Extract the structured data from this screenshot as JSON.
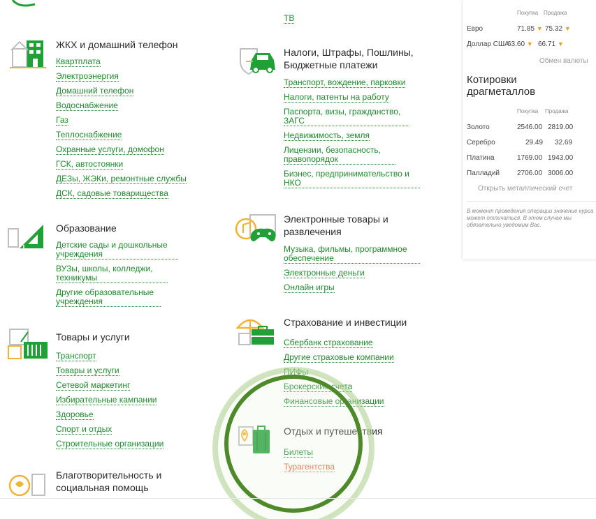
{
  "top_link": "ТВ",
  "categories_left": [
    {
      "title": "ЖКХ и домашний телефон",
      "links": [
        "Квартплата",
        "Электроэнергия",
        "Домашний телефон",
        "Водоснабжение",
        "Газ",
        "Теплоснабжение",
        "Охранные услуги, домофон",
        "ГСК, автостоянки",
        "ДЕЗы, ЖЭКи, ремонтные службы",
        "ДСК, садовые товарищества"
      ]
    },
    {
      "title": "Образование",
      "links": [
        "Детские сады и дошкольные учреждения",
        "ВУЗы, школы, колледжи, техникумы",
        "Другие образовательные учреждения"
      ]
    },
    {
      "title": "Товары и услуги",
      "links": [
        "Транспорт",
        "Товары и услуги",
        "Сетевой маркетинг",
        "Избирательные кампании",
        "Здоровье",
        "Спорт и отдых",
        "Строительные организации"
      ]
    },
    {
      "title": "Благотворительность и социальная помощь",
      "links": []
    }
  ],
  "categories_mid": [
    {
      "title": "Налоги, Штрафы, Пошлины, Бюджетные платежи",
      "links": [
        "Транспорт, вождение, парковки",
        "Налоги, патенты на работу",
        "Паспорта, визы, гражданство, ЗАГС",
        "Недвижимость, земля",
        "Лицензии, безопасность, правопорядок",
        "Бизнес, предпринимательство и НКО"
      ]
    },
    {
      "title": "Электронные товары и развлечения",
      "links": [
        "Музыка, фильмы, программное обеспечение",
        "Электронные деньги",
        "Онлайн игры"
      ]
    },
    {
      "title": "Страхование и инвестиции",
      "links": [
        "Сбербанк страхование",
        "Другие страховые компании",
        "ПИФы",
        "Брокерские счета",
        "Финансовые организации"
      ]
    },
    {
      "title": "Отдых и путешествия",
      "links": [
        "Билеты",
        "Турагентства"
      ]
    }
  ],
  "currency": {
    "header_buy": "Покупка",
    "header_sell": "Продажа",
    "rows": [
      {
        "name": "Евро",
        "buy": "71.85",
        "sell": "75.32"
      },
      {
        "name": "Доллар США",
        "buy": "63.60",
        "sell": "66.71"
      }
    ],
    "exchange_link": "Обмен валюты"
  },
  "metals": {
    "title": "Котировки драгметаллов",
    "header_buy": "Покупка",
    "header_sell": "Продажа",
    "rows": [
      {
        "name": "Золото",
        "buy": "2546.00",
        "sell": "2819.00"
      },
      {
        "name": "Серебро",
        "buy": "29.49",
        "sell": "32.69"
      },
      {
        "name": "Платина",
        "buy": "1769.00",
        "sell": "1943.00"
      },
      {
        "name": "Палладий",
        "buy": "2706.00",
        "sell": "3006.00"
      }
    ],
    "open_account": "Открыть металлический счет"
  },
  "note": "В момент проведения операции значение курса может отличаться. В этом случае мы обязательно уведомим Вас.",
  "colors": {
    "link_green": "#1f8a2c",
    "icon_green": "#21a038",
    "accent_orange": "#ef5b2a",
    "highlight_ring": "#4f8a2a"
  }
}
